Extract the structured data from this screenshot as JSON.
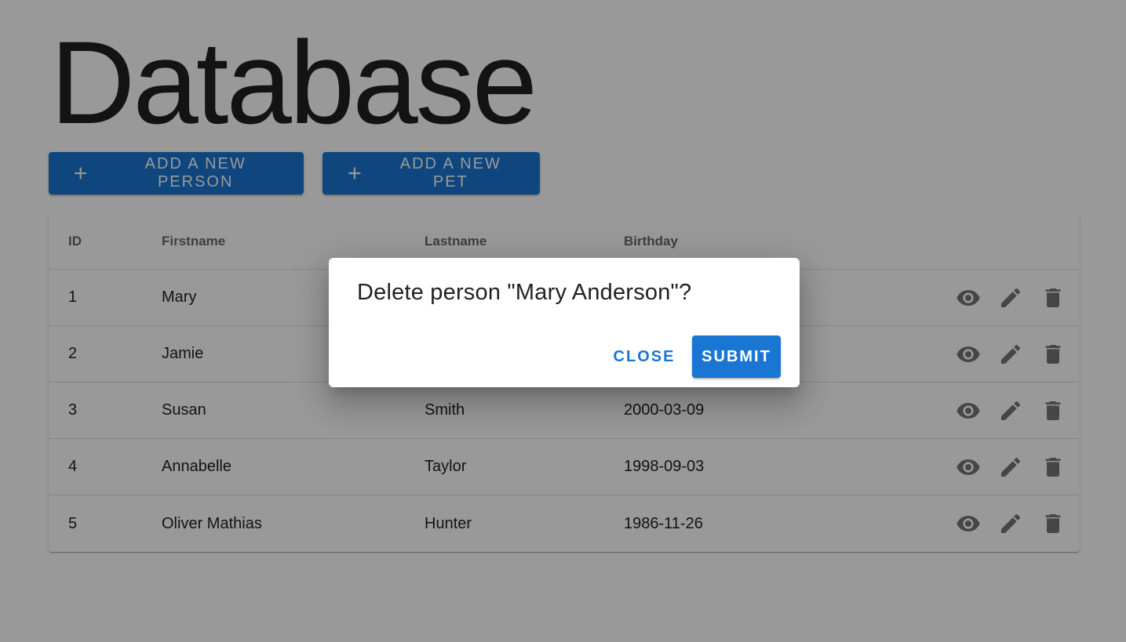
{
  "page": {
    "title": "Database"
  },
  "toolbar": {
    "add_person_label": "ADD A NEW PERSON",
    "add_pet_label": "ADD A NEW PET"
  },
  "table": {
    "headers": {
      "id": "ID",
      "firstname": "Firstname",
      "lastname": "Lastname",
      "birthday": "Birthday"
    },
    "rows": [
      {
        "id": "1",
        "firstname": "Mary",
        "lastname": "",
        "birthday": ""
      },
      {
        "id": "2",
        "firstname": "Jamie",
        "lastname": "",
        "birthday": ""
      },
      {
        "id": "3",
        "firstname": "Susan",
        "lastname": "Smith",
        "birthday": "2000-03-09"
      },
      {
        "id": "4",
        "firstname": "Annabelle",
        "lastname": "Taylor",
        "birthday": "1998-09-03"
      },
      {
        "id": "5",
        "firstname": "Oliver Mathias",
        "lastname": "Hunter",
        "birthday": "1986-11-26"
      }
    ],
    "row_actions": [
      "eye-icon",
      "pencil-icon",
      "trash-icon"
    ]
  },
  "dialog": {
    "title": "Delete person \"Mary Anderson\"?",
    "close_label": "CLOSE",
    "submit_label": "SUBMIT"
  },
  "colors": {
    "primary": "#1976d2",
    "overlay": "rgba(0,0,0,0.4)"
  }
}
